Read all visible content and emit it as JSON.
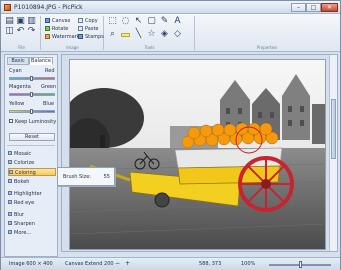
{
  "window": {
    "title": "P1010894.JPG - PicPick"
  },
  "ribbon": {
    "group_labels": {
      "file": "File",
      "image": "Image",
      "tools": "Tools",
      "properties": "Properties"
    },
    "image_commands": [
      "Canvas",
      "Rotate",
      "Watermark"
    ],
    "edit_commands": [
      "Copy",
      "Paste",
      "Stamps"
    ]
  },
  "left_panel": {
    "tabs": {
      "basic": "Basic",
      "balance": "Balance"
    },
    "balance_labels": {
      "cyan": "Cyan",
      "red": "Red",
      "magenta": "Magenta",
      "green": "Green",
      "yellow": "Yellow",
      "blue": "Blue"
    },
    "keep_luminosity": "Keep Luminosity",
    "reset_label": "Reset",
    "filters": [
      "Mosaic",
      "Colorize",
      "Coloring",
      "Bokeh",
      "Highlighter",
      "Red eye",
      "Blur",
      "Sharpen",
      "More..."
    ],
    "selected_filter": "Coloring"
  },
  "brush_popup": {
    "label": "Brush Size:",
    "value": "55"
  },
  "status": {
    "image_size": "Image  600 × 400",
    "canvas_extend": "Canvas Extend  200",
    "coords": "588, 373",
    "zoom": "100%"
  },
  "colors": {
    "accent": "#f5c85c",
    "close": "#c74a2f",
    "cart_yellow": "#f3cf1f",
    "wheel_red": "#c8242e",
    "oranges": "#f59a0d"
  }
}
